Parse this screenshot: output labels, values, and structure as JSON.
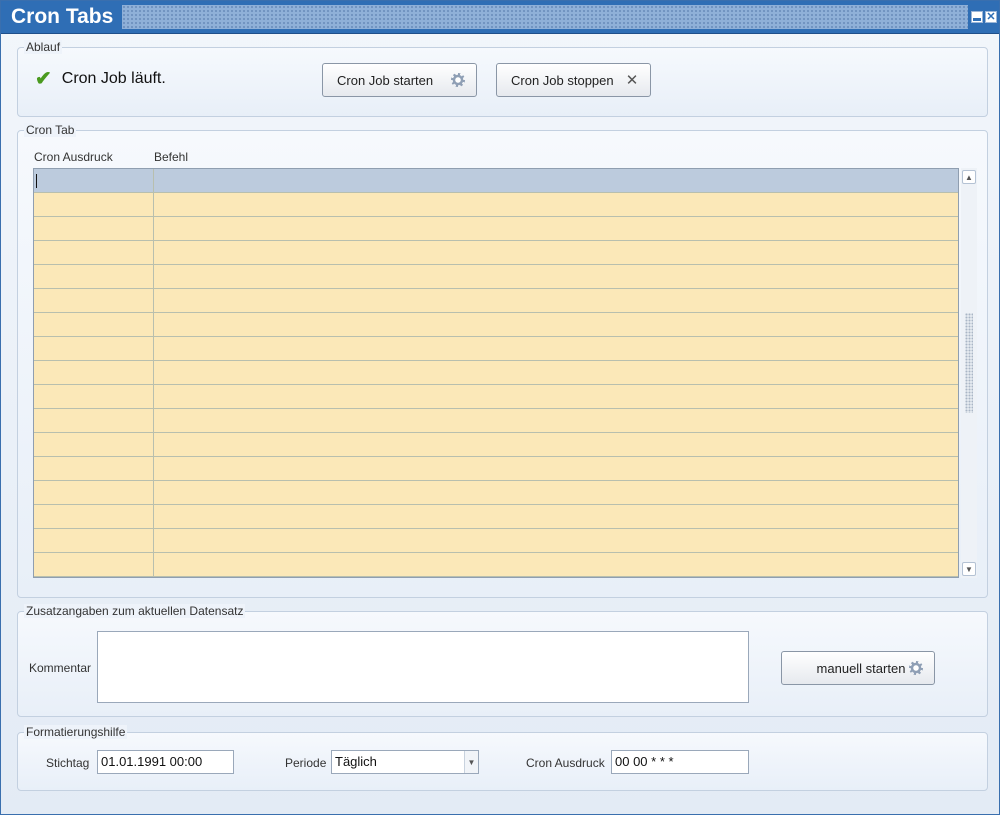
{
  "window": {
    "title": "Cron Tabs"
  },
  "ablauf": {
    "legend": "Ablauf",
    "status_text": "Cron Job läuft.",
    "start_label": "Cron Job starten",
    "stop_label": "Cron Job stoppen"
  },
  "crontab": {
    "legend": "Cron Tab",
    "columns": [
      "Cron Ausdruck",
      "Befehl"
    ],
    "row_count": 17
  },
  "zusatz": {
    "legend": "Zusatzangaben zum aktuellen Datensatz",
    "comment_label": "Kommentar",
    "comment_value": "",
    "manual_label": "manuell starten"
  },
  "format": {
    "legend": "Formatierungshilfe",
    "stichtag_label": "Stichtag",
    "stichtag_value": "01.01.1991 00:00",
    "periode_label": "Periode",
    "periode_value": "Täglich",
    "cron_label": "Cron Ausdruck",
    "cron_value": "00 00 * * *"
  },
  "colors": {
    "title_bar": "#2f6eb5",
    "row_fill": "#fbe8b8",
    "selected_row": "#bccbdd",
    "status_check": "#4a9a1f"
  }
}
